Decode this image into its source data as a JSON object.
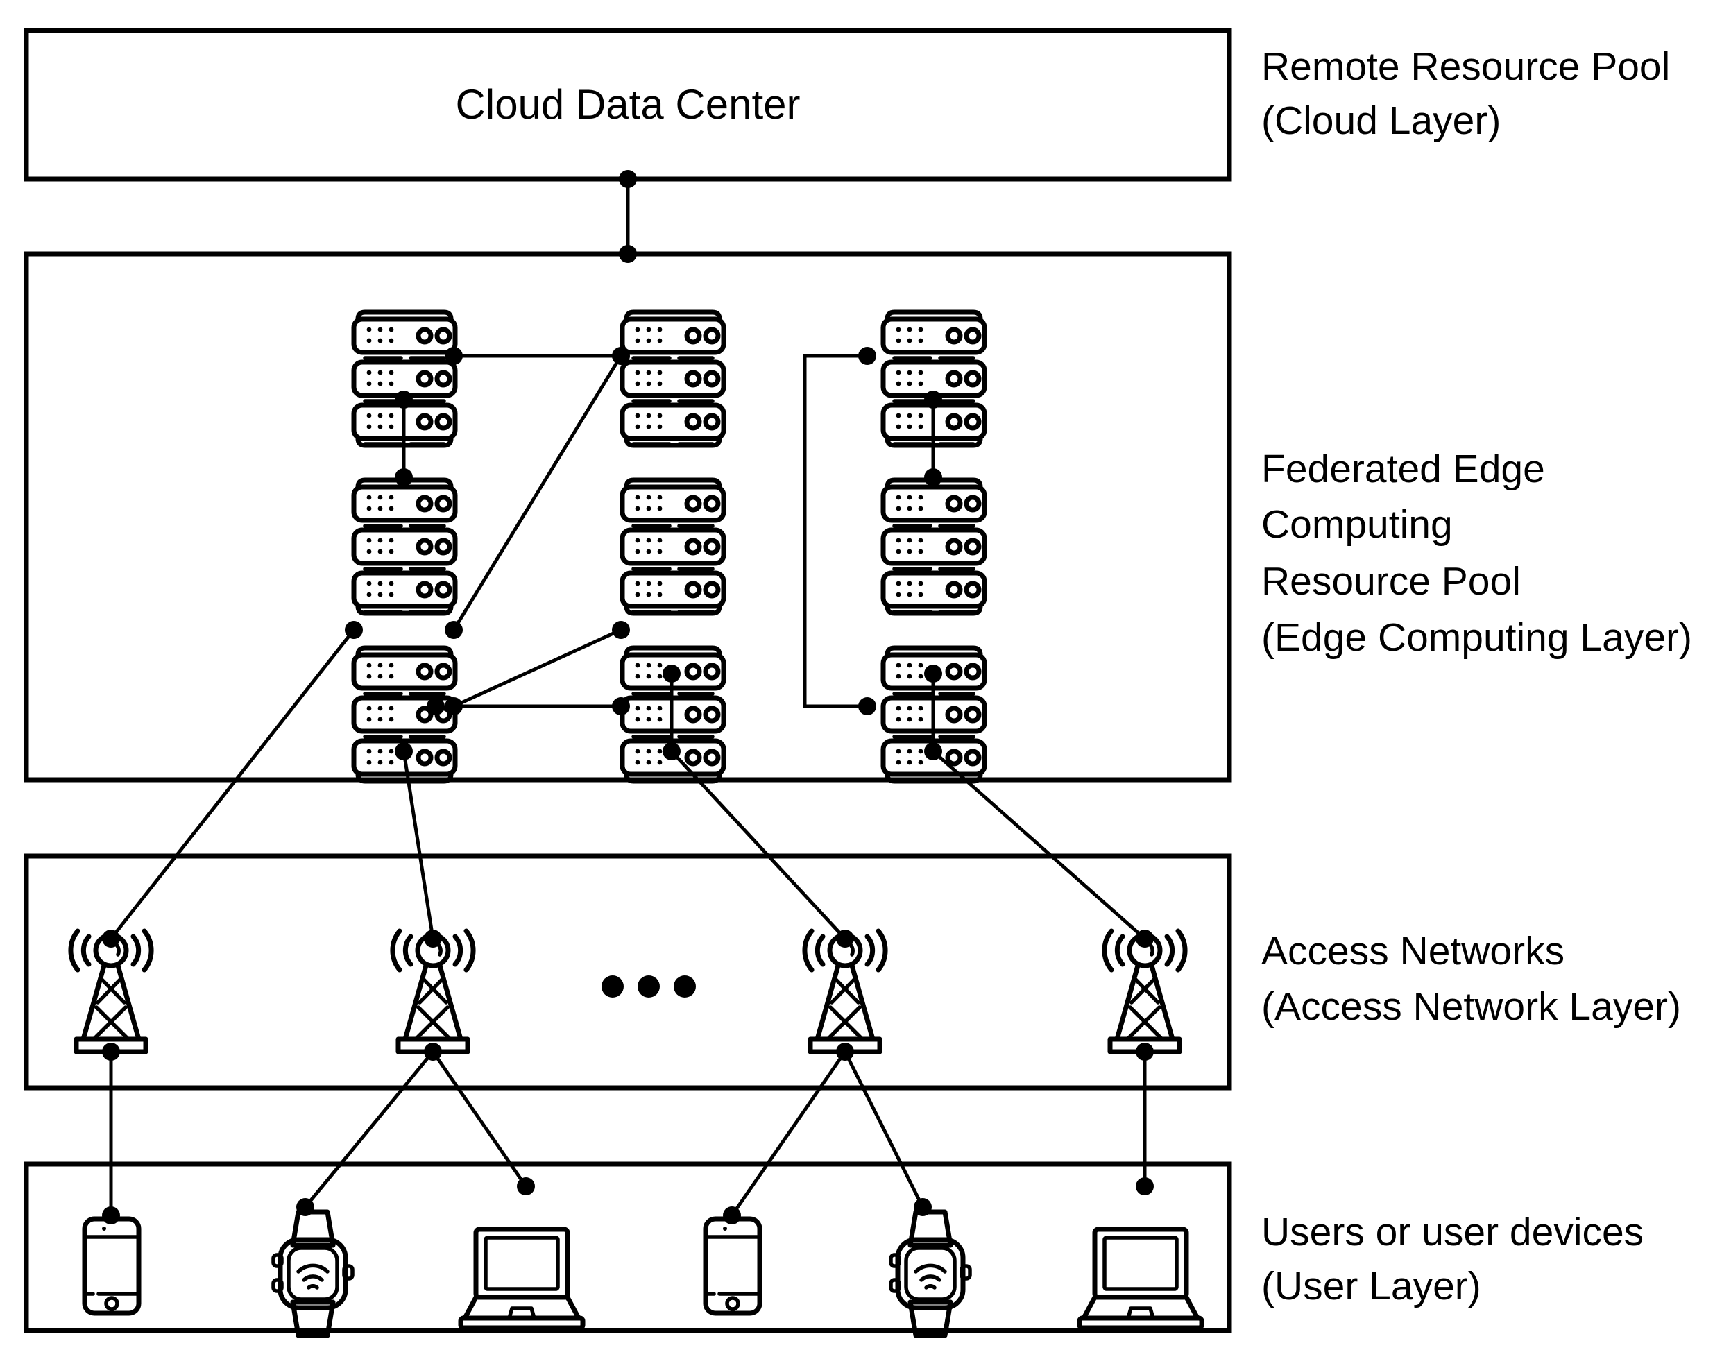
{
  "diagram": {
    "title": "Cloud Data Center",
    "layers": [
      {
        "id": "cloud-layer",
        "box_title": "Cloud Data Center",
        "label_line1": "Remote Resource Pool",
        "label_line2": "(Cloud Layer)"
      },
      {
        "id": "edge-layer",
        "box_title": "",
        "label_line1": "Federated Edge",
        "label_line2": "Computing",
        "label_line3": "Resource Pool",
        "label_line4": "(Edge Computing Layer)"
      },
      {
        "id": "access-layer",
        "box_title": "",
        "label_line1": "Access Networks",
        "label_line2": "(Access Network Layer)"
      },
      {
        "id": "user-layer",
        "box_title": "",
        "label_line1": "Users or user devices",
        "label_line2": "(User Layer)"
      }
    ],
    "edge_nodes": [
      {
        "id": "E1",
        "name": "edge-server-top-left",
        "icon": "server-rack-icon"
      },
      {
        "id": "E2",
        "name": "edge-server-top-middle",
        "icon": "server-rack-icon"
      },
      {
        "id": "E3",
        "name": "edge-server-top-right",
        "icon": "server-rack-icon"
      },
      {
        "id": "E4",
        "name": "edge-server-mid-left",
        "icon": "server-rack-icon"
      },
      {
        "id": "E5",
        "name": "edge-server-mid-middle",
        "icon": "server-rack-icon"
      },
      {
        "id": "E6",
        "name": "edge-server-mid-right",
        "icon": "server-rack-icon"
      },
      {
        "id": "E7",
        "name": "edge-server-bottom-left",
        "icon": "server-rack-icon"
      },
      {
        "id": "E8",
        "name": "edge-server-bottom-middle",
        "icon": "server-rack-icon"
      },
      {
        "id": "E9",
        "name": "edge-server-bottom-right",
        "icon": "server-rack-icon"
      }
    ],
    "access_nodes": [
      {
        "id": "A1",
        "name": "access-tower-1",
        "icon": "cell-tower-icon"
      },
      {
        "id": "A2",
        "name": "access-tower-2",
        "icon": "cell-tower-icon"
      },
      {
        "id": "A3",
        "name": "access-tower-3",
        "icon": "cell-tower-icon"
      },
      {
        "id": "A4",
        "name": "access-tower-4",
        "icon": "cell-tower-icon"
      }
    ],
    "access_ellipsis": "• • •",
    "user_nodes": [
      {
        "id": "U1",
        "name": "user-device-smartphone-1",
        "icon": "smartphone-icon"
      },
      {
        "id": "U2",
        "name": "user-device-smartwatch-1",
        "icon": "smartwatch-icon"
      },
      {
        "id": "U3",
        "name": "user-device-laptop-1",
        "icon": "laptop-icon"
      },
      {
        "id": "U4",
        "name": "user-device-smartphone-2",
        "icon": "smartphone-icon"
      },
      {
        "id": "U5",
        "name": "user-device-smartwatch-2",
        "icon": "smartwatch-icon"
      },
      {
        "id": "U6",
        "name": "user-device-laptop-2",
        "icon": "laptop-icon"
      }
    ],
    "connections": [
      {
        "from": "Cloud Data Center",
        "to": "Edge Computing Layer"
      },
      {
        "from": "E1",
        "to": "E2"
      },
      {
        "from": "E1",
        "to": "E4"
      },
      {
        "from": "E2",
        "to": "E4"
      },
      {
        "from": "E3",
        "to": "E6"
      },
      {
        "from": "E3",
        "to": "E9"
      },
      {
        "from": "E5",
        "to": "E8"
      },
      {
        "from": "E5",
        "to": "E7"
      },
      {
        "from": "E6",
        "to": "E9"
      },
      {
        "from": "E7",
        "to": "E8"
      },
      {
        "from": "E4",
        "to": "A1"
      },
      {
        "from": "E7",
        "to": "A2"
      },
      {
        "from": "E8",
        "to": "A3"
      },
      {
        "from": "E9",
        "to": "A4"
      },
      {
        "from": "A1",
        "to": "U1"
      },
      {
        "from": "A2",
        "to": "U2"
      },
      {
        "from": "A2",
        "to": "U3"
      },
      {
        "from": "A3",
        "to": "U4"
      },
      {
        "from": "A3",
        "to": "U5"
      },
      {
        "from": "A4",
        "to": "U6"
      }
    ],
    "colors": {
      "stroke": "#000000",
      "background": "#ffffff"
    }
  }
}
